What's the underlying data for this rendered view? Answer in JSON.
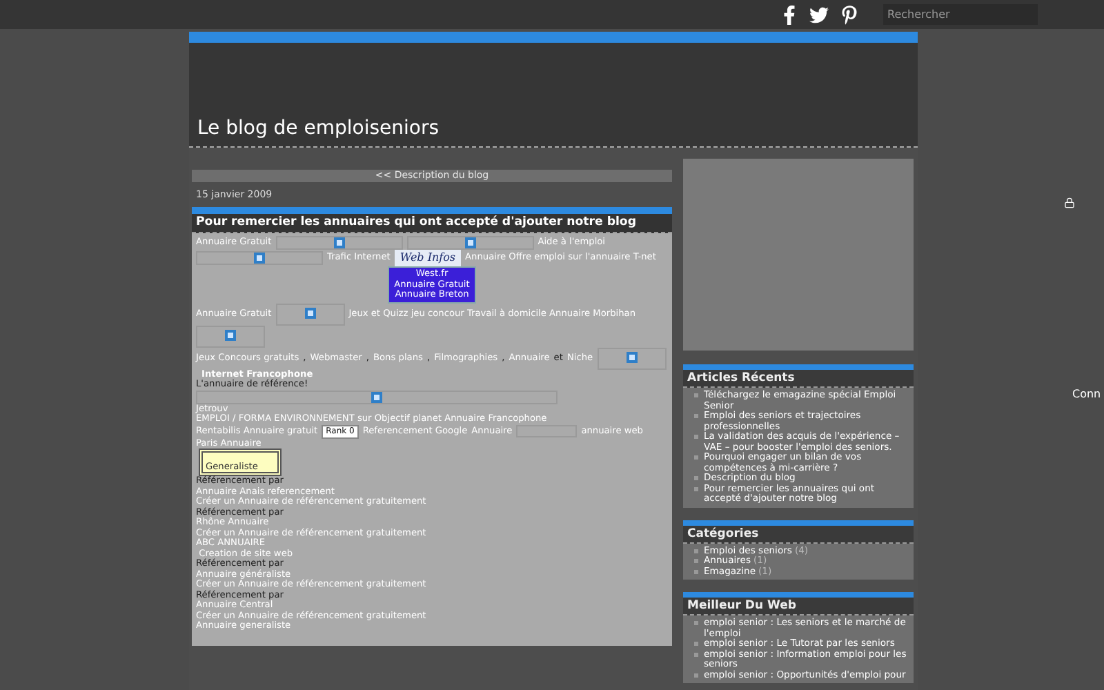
{
  "topbar": {
    "search": {
      "placeholder": "Rechercher"
    }
  },
  "header": {
    "title": "Le blog de emploiseniors"
  },
  "nav_link": "<< Description du blog",
  "post": {
    "date": "15 janvier 2009",
    "title": "Pour remercier les annuaires qui ont accepté d'ajouter notre blog",
    "paragraphs": [
      {
        "segments": [
          {
            "kind": "link",
            "text": "Annuaire Gratuit"
          },
          {
            "kind": "banner"
          },
          {
            "kind": "banner"
          },
          {
            "kind": "link",
            "text": "Aide à l'emploi"
          }
        ]
      },
      {
        "segments": [
          {
            "kind": "banner"
          },
          {
            "kind": "link",
            "text": "Trafic Internet"
          },
          {
            "kind": "logo",
            "text": "Web Infos"
          },
          {
            "kind": "link",
            "text": "Annuaire Offre emploi sur l'annuaire T-net"
          }
        ]
      },
      {
        "segments": [
          {
            "kind": "promo",
            "lines": [
              "West.fr",
              "Annuaire Gratuit",
              "Annuaire Breton"
            ]
          }
        ]
      },
      {
        "segments": [
          {
            "kind": "link",
            "text": "Annuaire Gratuit"
          },
          {
            "kind": "tile"
          },
          {
            "kind": "link",
            "text": "Jeux et Quizz jeu concour Travail à domicile Annuaire Morbihan"
          }
        ]
      },
      {
        "segments": [
          {
            "kind": "tile"
          }
        ]
      },
      {
        "segments": [
          {
            "kind": "link",
            "text": "Jeux Concours gratuits"
          },
          {
            "kind": "text",
            "text": ","
          },
          {
            "kind": "link",
            "text": "Webmaster"
          },
          {
            "kind": "text",
            "text": ","
          },
          {
            "kind": "link",
            "text": "Bons plans"
          },
          {
            "kind": "text",
            "text": ","
          },
          {
            "kind": "link",
            "text": "Filmographies"
          },
          {
            "kind": "text",
            "text": ","
          },
          {
            "kind": "link",
            "text": "Annuaire"
          },
          {
            "kind": "text",
            "text": "et"
          },
          {
            "kind": "link",
            "text": "Niche"
          },
          {
            "kind": "tile"
          }
        ]
      },
      {
        "segments": [
          {
            "kind": "heading",
            "text": "Internet Francophone"
          }
        ]
      },
      {
        "segments": [
          {
            "kind": "text",
            "text": "L'annuaire de référence!"
          }
        ]
      },
      {
        "segments": [
          {
            "kind": "strip"
          }
        ]
      },
      {
        "segments": [
          {
            "kind": "link",
            "text": "Jetrouv"
          }
        ]
      },
      {
        "segments": [
          {
            "kind": "link",
            "text": "EMPLOI / FORMA ENVIRONNEMENT sur Objectif planet Annuaire Francophone"
          }
        ]
      },
      {
        "segments": [
          {
            "kind": "link",
            "text": "Rentabilis Annuaire gratuit"
          },
          {
            "kind": "rank",
            "text": "Rank  0"
          },
          {
            "kind": "link",
            "text": "Referencement Google"
          },
          {
            "kind": "link",
            "text": "Annuaire"
          },
          {
            "kind": "field"
          },
          {
            "kind": "link",
            "text": "annuaire web"
          }
        ]
      },
      {
        "segments": [
          {
            "kind": "link",
            "text": "Paris Annuaire"
          }
        ]
      },
      {
        "segments": [
          {
            "kind": "badge",
            "text": "Generaliste"
          }
        ]
      },
      {
        "segments": [
          {
            "kind": "text",
            "text": "Référencement par"
          }
        ]
      },
      {
        "segments": [
          {
            "kind": "link",
            "text": "Annuaire Anais referencement"
          }
        ]
      },
      {
        "segments": [
          {
            "kind": "link",
            "text": "Créer un Annuaire de référencement gratuitement"
          }
        ]
      },
      {
        "segments": [
          {
            "kind": "text",
            "text": "Référencement par"
          }
        ]
      },
      {
        "segments": [
          {
            "kind": "link",
            "text": "Rhône Annuaire"
          }
        ]
      },
      {
        "segments": [
          {
            "kind": "link",
            "text": "Créer un Annuaire de référencement gratuitement"
          }
        ]
      },
      {
        "segments": [
          {
            "kind": "link",
            "text": "ABC ANNUAIRE"
          }
        ]
      },
      {
        "segments": [
          {
            "kind": "link",
            "text": " Creation de site web"
          }
        ]
      },
      {
        "segments": [
          {
            "kind": "text",
            "text": "Référencement par"
          }
        ]
      },
      {
        "segments": [
          {
            "kind": "link",
            "text": "Annuaire généraliste"
          }
        ]
      },
      {
        "segments": [
          {
            "kind": "link",
            "text": "Créer un Annuaire de référencement gratuitement"
          }
        ]
      },
      {
        "segments": [
          {
            "kind": "text",
            "text": "Référencement par"
          }
        ]
      },
      {
        "segments": [
          {
            "kind": "link",
            "text": "Annuaire Central"
          }
        ]
      },
      {
        "segments": [
          {
            "kind": "link",
            "text": "Créer un Annuaire de référencement gratuitement"
          }
        ]
      },
      {
        "segments": [
          {
            "kind": "link",
            "text": "Annuaire generaliste"
          }
        ]
      }
    ]
  },
  "sidebar": {
    "widgets": [
      {
        "title": "Articles Récents",
        "items": [
          {
            "label": "Téléchargez le emagazine spécial Emploi Senior"
          },
          {
            "label": "Emploi des seniors et trajectoires professionnelles"
          },
          {
            "label": "La validation des acquis de l'expérience – VAE – pour booster l'emploi des seniors."
          },
          {
            "label": "Pourquoi engager un bilan de vos compétences à mi-carrière ?"
          },
          {
            "label": "Description du blog"
          },
          {
            "label": "Pour remercier les annuaires qui ont accepté d'ajouter notre blog"
          }
        ]
      },
      {
        "title": "Catégories",
        "items": [
          {
            "label": "Emploi des seniors",
            "count": "(4)"
          },
          {
            "label": "Annuaires",
            "count": "(1)"
          },
          {
            "label": "Emagazine",
            "count": "(1)"
          }
        ]
      },
      {
        "title": "Meilleur Du Web",
        "items": [
          {
            "label": "emploi senior : Les seniors et le marché de l'emploi"
          },
          {
            "label": "emploi senior : Le Tutorat par les seniors"
          },
          {
            "label": "emploi senior : Information emploi pour les seniors"
          },
          {
            "label": "emploi senior : Opportunités d'emploi pour"
          }
        ]
      }
    ]
  },
  "side_label": "Conn"
}
